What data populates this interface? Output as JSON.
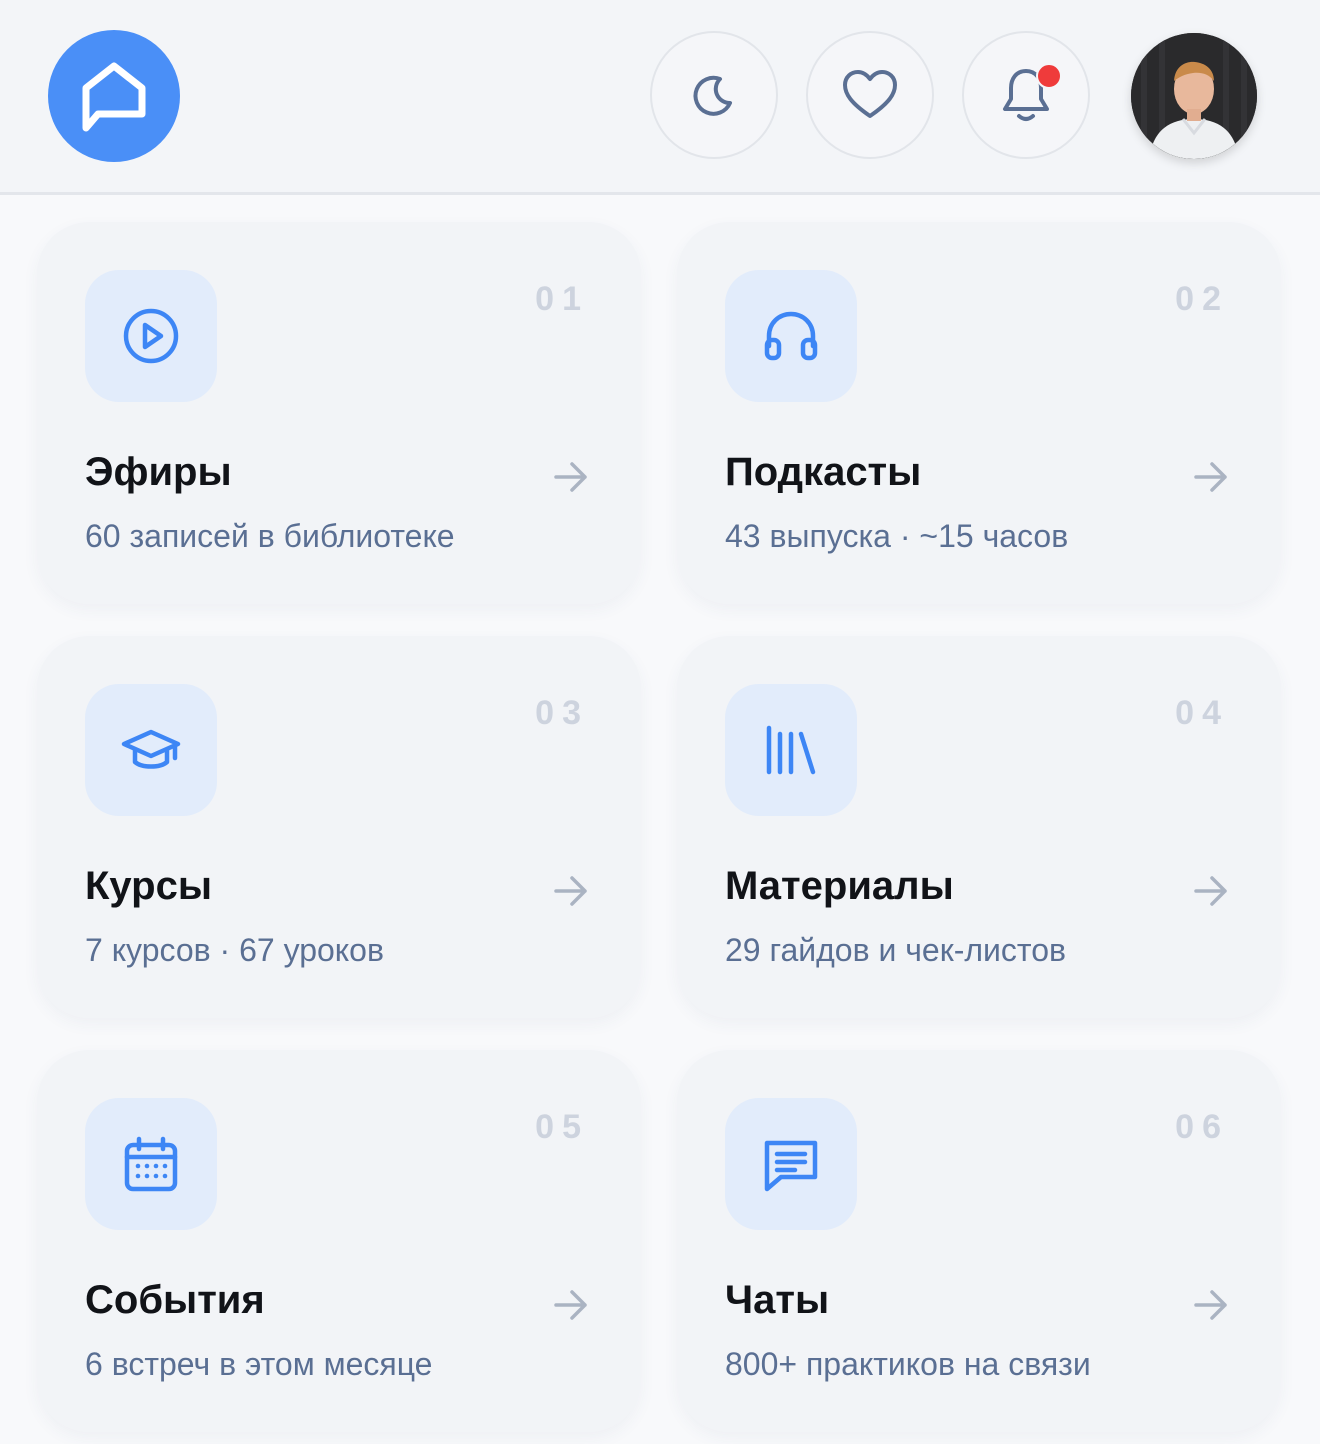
{
  "header": {
    "logo_icon": "home-chat-icon",
    "buttons": [
      {
        "name": "theme-toggle-button",
        "icon": "moon-icon"
      },
      {
        "name": "favorites-button",
        "icon": "heart-icon"
      },
      {
        "name": "notifications-button",
        "icon": "bell-icon",
        "has_unread": true
      }
    ],
    "avatar_icon": "user-avatar"
  },
  "colors": {
    "accent": "#4a8ff7",
    "icon_bg": "#e2ecfb",
    "card_bg": "#f2f4f7",
    "subtitle": "#5a6f93",
    "number": "#cdd3de",
    "notification_dot": "#ef3b3b"
  },
  "cards": [
    {
      "num": "01",
      "title": "Эфиры",
      "subtitle": "60 записей в библиотеке",
      "icon": "play-circle-icon"
    },
    {
      "num": "02",
      "title": "Подкасты",
      "subtitle": "43 выпуска · ~15 часов",
      "icon": "headphones-icon"
    },
    {
      "num": "03",
      "title": "Курсы",
      "subtitle": "7 курсов · 67 уроков",
      "icon": "graduation-cap-icon"
    },
    {
      "num": "04",
      "title": "Материалы",
      "subtitle": "29 гайдов и чек-листов",
      "icon": "library-icon"
    },
    {
      "num": "05",
      "title": "События",
      "subtitle": "6 встреч в этом месяце",
      "icon": "calendar-icon"
    },
    {
      "num": "06",
      "title": "Чаты",
      "subtitle": "800+ практиков на связи",
      "icon": "chat-icon"
    }
  ]
}
